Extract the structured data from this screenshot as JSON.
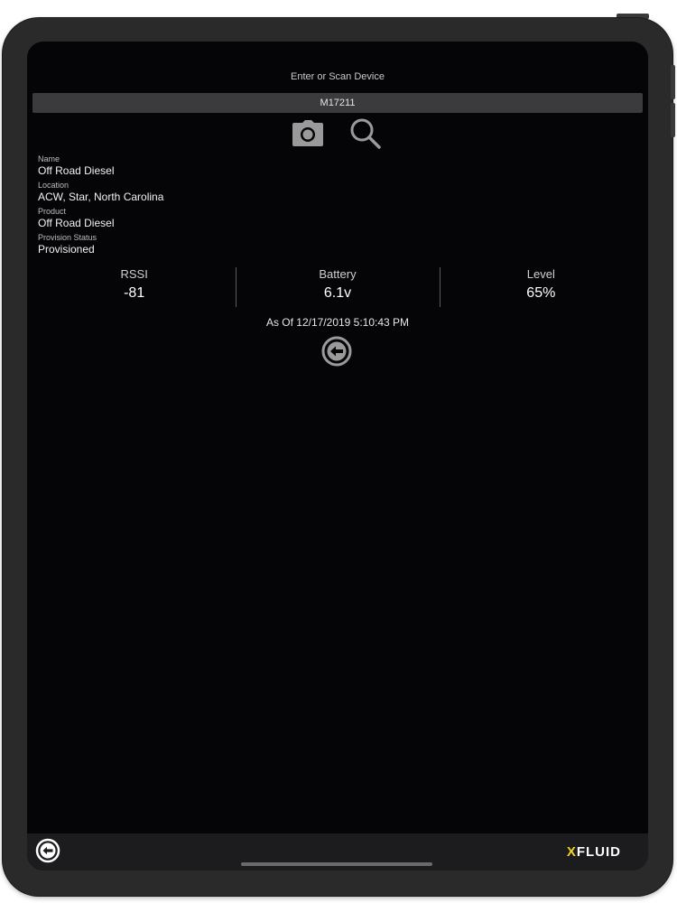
{
  "scan": {
    "label": "Enter or Scan Device",
    "device_id": "M17211"
  },
  "icons": {
    "camera": "camera-icon",
    "search": "search-icon",
    "back": "back-arrow-circle-icon"
  },
  "details": {
    "name_label": "Name",
    "name_value": "Off Road Diesel",
    "location_label": "Location",
    "location_value": "ACW, Star, North Carolina",
    "product_label": "Product",
    "product_value": "Off Road Diesel",
    "provision_label": "Provision Status",
    "provision_value": "Provisioned"
  },
  "stats": {
    "rssi_label": "RSSI",
    "rssi_value": "-81",
    "battery_label": "Battery",
    "battery_value": "6.1v",
    "level_label": "Level",
    "level_value": "65%"
  },
  "as_of": "As Of 12/17/2019 5:10:43 PM",
  "footer": {
    "logo_x": "X",
    "logo_rest": "FLUID"
  },
  "colors": {
    "background": "#050507",
    "input": "#3b3b3d",
    "icon": "#9a9a9a",
    "logo_accent": "#f2d12a"
  }
}
